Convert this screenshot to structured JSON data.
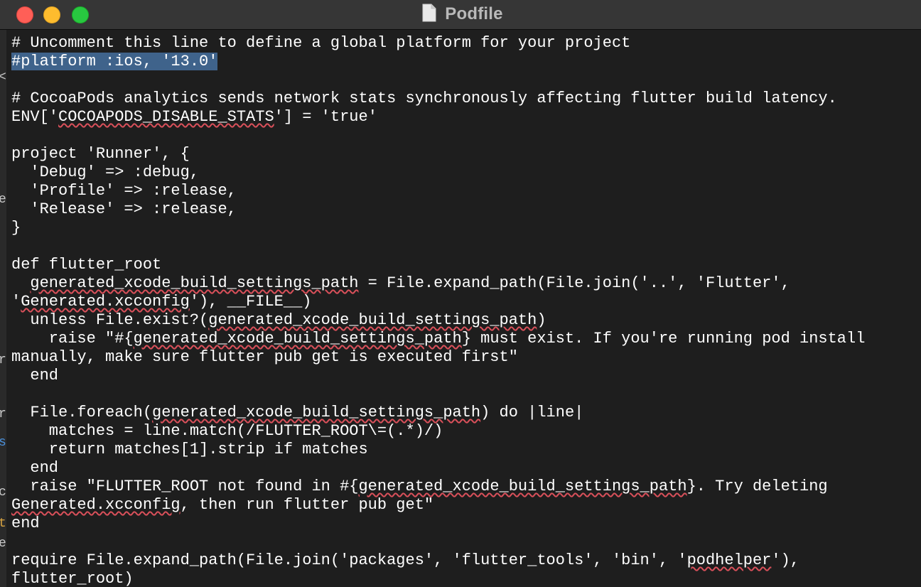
{
  "window": {
    "title": "Podfile",
    "file_icon": "document-icon",
    "buttons": {
      "close": "close-button",
      "minimize": "minimize-button",
      "zoom": "zoom-button"
    }
  },
  "gutter": {
    "glyphs": [
      "<",
      "e",
      "r",
      "r",
      "s",
      "c",
      "t",
      "e"
    ]
  },
  "colors": {
    "background": "#1e1e1e",
    "titlebar": "#363636",
    "text": "#ffffff",
    "selection": "#3f638b",
    "spellcheck_underline": "#d9505a"
  },
  "editor": {
    "selected_line_index": 1,
    "lines": [
      [
        {
          "t": "# Uncomment this line to define a global platform for your project"
        }
      ],
      [
        {
          "t": "#platform :ios, '13.0'",
          "sel": true
        }
      ],
      [],
      [
        {
          "t": "# CocoaPods analytics sends network stats synchronously affecting flutter build latency."
        }
      ],
      [
        {
          "t": "ENV['"
        },
        {
          "t": "COCOAPODS_DISABLE_STATS",
          "sp": true
        },
        {
          "t": "'] = 'true'"
        }
      ],
      [],
      [
        {
          "t": "project 'Runner', {"
        }
      ],
      [
        {
          "t": "  'Debug' => :debug,"
        }
      ],
      [
        {
          "t": "  'Profile' => :release,"
        }
      ],
      [
        {
          "t": "  'Release' => :release,"
        }
      ],
      [
        {
          "t": "}"
        }
      ],
      [],
      [
        {
          "t": "def flutter_root"
        }
      ],
      [
        {
          "t": "  "
        },
        {
          "t": "generated_xcode_build_settings_path",
          "sp": true
        },
        {
          "t": " = File.expand_path(File.join('..', 'Flutter',"
        }
      ],
      [
        {
          "t": "'"
        },
        {
          "t": "Generated.xcconfig",
          "sp": true
        },
        {
          "t": "'), __FILE__)"
        }
      ],
      [
        {
          "t": "  unless File.exist?("
        },
        {
          "t": "generated_xcode_build_settings_path",
          "sp": true
        },
        {
          "t": ")"
        }
      ],
      [
        {
          "t": "    raise \"#{"
        },
        {
          "t": "generated_xcode_build_settings_path",
          "sp": true
        },
        {
          "t": "} must exist. If you're running pod install"
        }
      ],
      [
        {
          "t": "manually, make sure flutter pub get is executed first\""
        }
      ],
      [
        {
          "t": "  end"
        }
      ],
      [],
      [
        {
          "t": "  File.foreach("
        },
        {
          "t": "generated_xcode_build_settings_path",
          "sp": true
        },
        {
          "t": ") do |line|"
        }
      ],
      [
        {
          "t": "    matches = line.match(/FLUTTER_ROOT\\=(.*)/)"
        }
      ],
      [
        {
          "t": "    return matches[1].strip if matches"
        }
      ],
      [
        {
          "t": "  end"
        }
      ],
      [
        {
          "t": "  raise \"FLUTTER_ROOT not found in #{"
        },
        {
          "t": "generated_xcode_build_settings_path",
          "sp": true
        },
        {
          "t": "}. Try deleting"
        }
      ],
      [
        {
          "t": "Generated.xcconfig",
          "sp": true
        },
        {
          "t": ", then run flutter pub get\""
        }
      ],
      [
        {
          "t": "end"
        }
      ],
      [],
      [
        {
          "t": "require File.expand_path(File.join('packages', 'flutter_tools', 'bin', '"
        },
        {
          "t": "podhelper",
          "sp": true
        },
        {
          "t": "'),"
        }
      ],
      [
        {
          "t": "flutter_root)"
        }
      ]
    ]
  }
}
